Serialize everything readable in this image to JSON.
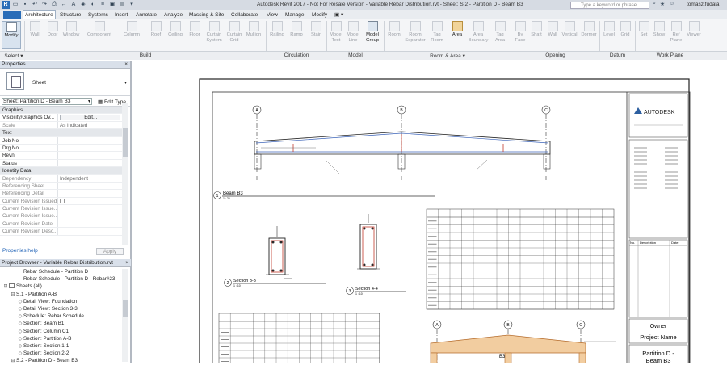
{
  "title_bar": {
    "window_title": "Autodesk Revit 2017 - Not For Resale Version - Variable Rebar Distribution.rvt - Sheet: S.2 - Partition D - Beam B3",
    "search_placeholder": "Type a keyword or phrase",
    "user_name": "tomasz.fudala"
  },
  "tabs": [
    "Architecture",
    "Structure",
    "Systems",
    "Insert",
    "Annotate",
    "Analyze",
    "Massing & Site",
    "Collaborate",
    "View",
    "Manage",
    "Modify"
  ],
  "active_tab": "Architecture",
  "ribbon": {
    "buttons": [
      {
        "label": "Modify",
        "icon": "cursor-icon",
        "enabled": true
      },
      {
        "label": "Wall",
        "icon": "wall-icon",
        "enabled": false
      },
      {
        "label": "Door",
        "icon": "door-icon",
        "enabled": false
      },
      {
        "label": "Window",
        "icon": "window-icon",
        "enabled": false
      },
      {
        "label": "Component",
        "icon": "component-icon",
        "enabled": false
      },
      {
        "label": "Column",
        "icon": "column-icon",
        "enabled": false
      },
      {
        "label": "Roof",
        "icon": "roof-icon",
        "enabled": false
      },
      {
        "label": "Ceiling",
        "icon": "ceiling-icon",
        "enabled": false
      },
      {
        "label": "Floor",
        "icon": "floor-icon",
        "enabled": false
      },
      {
        "label": "Curtain System",
        "icon": "curtain-system-icon",
        "enabled": false
      },
      {
        "label": "Curtain Grid",
        "icon": "curtain-grid-icon",
        "enabled": false
      },
      {
        "label": "Mullion",
        "icon": "mullion-icon",
        "enabled": false
      },
      {
        "label": "Railing",
        "icon": "railing-icon",
        "enabled": false
      },
      {
        "label": "Ramp",
        "icon": "ramp-icon",
        "enabled": false
      },
      {
        "label": "Stair",
        "icon": "stair-icon",
        "enabled": false
      },
      {
        "label": "Model Text",
        "icon": "model-text-icon",
        "enabled": false
      },
      {
        "label": "Model Line",
        "icon": "model-line-icon",
        "enabled": false
      },
      {
        "label": "Model Group",
        "icon": "model-group-icon",
        "enabled": true
      },
      {
        "label": "Room",
        "icon": "room-icon",
        "enabled": false
      },
      {
        "label": "Room Separator",
        "icon": "room-separator-icon",
        "enabled": false
      },
      {
        "label": "Tag Room",
        "icon": "tag-room-icon",
        "enabled": false
      },
      {
        "label": "Area",
        "icon": "area-icon",
        "enabled": true,
        "selected": true
      },
      {
        "label": "Area Boundary",
        "icon": "area-boundary-icon",
        "enabled": false
      },
      {
        "label": "Tag Area",
        "icon": "tag-area-icon",
        "enabled": false
      },
      {
        "label": "By Face",
        "icon": "by-face-icon",
        "enabled": false
      },
      {
        "label": "Shaft",
        "icon": "shaft-icon",
        "enabled": false
      },
      {
        "label": "Wall",
        "icon": "wall-opening-icon",
        "enabled": false
      },
      {
        "label": "Vertical",
        "icon": "vertical-opening-icon",
        "enabled": false
      },
      {
        "label": "Dormer",
        "icon": "dormer-icon",
        "enabled": false
      },
      {
        "label": "Level",
        "icon": "level-icon",
        "enabled": false
      },
      {
        "label": "Grid",
        "icon": "grid-icon",
        "enabled": false
      },
      {
        "label": "Set",
        "icon": "set-icon",
        "enabled": false
      },
      {
        "label": "Show",
        "icon": "show-icon",
        "enabled": false
      },
      {
        "label": "Ref Plane",
        "icon": "ref-plane-icon",
        "enabled": false
      },
      {
        "label": "Viewer",
        "icon": "viewer-icon",
        "enabled": false
      }
    ],
    "panels": [
      "Select ▾",
      "Build",
      "Circulation",
      "Model",
      "Room & Area ▾",
      "Opening",
      "Datum",
      "Work Plane"
    ]
  },
  "properties": {
    "header": "Properties",
    "type_name": "Sheet",
    "instance_selector": "Sheet: Partition D - Beam B3",
    "edit_type": "Edit Type",
    "rows": [
      {
        "k": "Graphics",
        "v": "",
        "group": true
      },
      {
        "k": "Visibility/Graphics Ov...",
        "v": "Edit...",
        "button": true
      },
      {
        "k": "Scale",
        "v": "As indicated",
        "dim": true
      },
      {
        "k": "Text",
        "v": "",
        "group": true
      },
      {
        "k": "Job No",
        "v": ""
      },
      {
        "k": "Drg No",
        "v": ""
      },
      {
        "k": "Revn",
        "v": ""
      },
      {
        "k": "Status",
        "v": ""
      },
      {
        "k": "Identity Data",
        "v": "",
        "group": true
      },
      {
        "k": "Dependency",
        "v": "Independent",
        "dim": true
      },
      {
        "k": "Referencing Sheet",
        "v": "",
        "dim": true
      },
      {
        "k": "Referencing Detail",
        "v": "",
        "dim": true
      },
      {
        "k": "Current Revision Issued",
        "v": "",
        "dim": true,
        "checkbox": true
      },
      {
        "k": "Current Revision Issue...",
        "v": "",
        "dim": true
      },
      {
        "k": "Current Revision Issue...",
        "v": "",
        "dim": true
      },
      {
        "k": "Current Revision Date",
        "v": "",
        "dim": true
      },
      {
        "k": "Current Revision Desc...",
        "v": "",
        "dim": true
      }
    ],
    "help_link": "Properties help",
    "apply": "Apply"
  },
  "project_browser": {
    "header": "Project Browser - Variable Rebar Distribution.rvt",
    "items": [
      {
        "label": "Rebar Schedule - Partition D",
        "level": 2,
        "toggle": ""
      },
      {
        "label": "Rebar Schedule - Partition D - Rebar#23",
        "level": 2,
        "toggle": ""
      },
      {
        "label": "Sheets (all)",
        "level": 0,
        "toggle": "⊟",
        "icon": true
      },
      {
        "label": "S.1 - Partition A-B",
        "level": 1,
        "toggle": "⊟"
      },
      {
        "label": "Detail View: Foundation",
        "level": 2,
        "toggle": "◇"
      },
      {
        "label": "Detail View: Section 3-3",
        "level": 2,
        "toggle": "◇"
      },
      {
        "label": "Schedule: Rebar Schedule",
        "level": 2,
        "toggle": "◇"
      },
      {
        "label": "Section: Beam B1",
        "level": 2,
        "toggle": "◇"
      },
      {
        "label": "Section: Column C1",
        "level": 2,
        "toggle": "◇"
      },
      {
        "label": "Section: Partition A-B",
        "level": 2,
        "toggle": "◇"
      },
      {
        "label": "Section: Section 1-1",
        "level": 2,
        "toggle": "◇"
      },
      {
        "label": "Section: Section 2-2",
        "level": 2,
        "toggle": "◇"
      },
      {
        "label": "S.2 - Partition D - Beam B3",
        "level": 1,
        "toggle": "⊟"
      }
    ]
  },
  "sheet": {
    "logo": "AUTODESK",
    "views": [
      {
        "title": "Beam B3",
        "scale": "1 : 25",
        "num": "1"
      },
      {
        "title": "Section 3-3",
        "scale": "1 : 10",
        "num": "2"
      },
      {
        "title": "Section 4-4",
        "scale": "1 : 10",
        "num": "3"
      }
    ],
    "grids": [
      "A",
      "B",
      "C"
    ],
    "lower_label": "B3",
    "revision_headers": [
      "No.",
      "Description",
      "Date"
    ],
    "owner": "Owner",
    "project": "Project Name",
    "sheet_title": "Partition D - Beam B3"
  }
}
